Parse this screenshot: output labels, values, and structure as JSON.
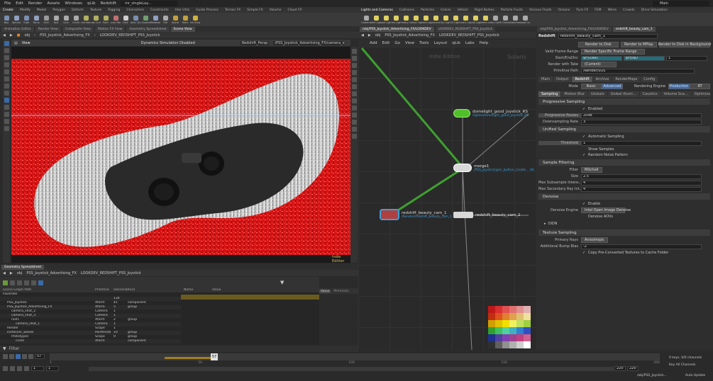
{
  "menu": [
    "File",
    "Edit",
    "Render",
    "Assets",
    "Windows",
    "qLib",
    "Redshift",
    "Labs",
    "Help"
  ],
  "desktop": "mr_singleLay...",
  "workspace": "Main",
  "shelf_tabs_left": [
    "Create",
    "Modify",
    "Model",
    "Polygon",
    "Deform",
    "Texture",
    "Rigging",
    "Characters",
    "Constraints",
    "Hair Utils",
    "Guide Process",
    "Terrain FX",
    "Simple FX",
    "Volume",
    "Cloud FX"
  ],
  "shelf_tabs_right": [
    "Lights and Cameras",
    "Collisions",
    "Particles",
    "Grains",
    "Vellum",
    "Rigid Bodies",
    "Particle Fluids",
    "Viscous Fluids",
    "Oceans",
    "Pyro FX",
    "FEM",
    "Wires",
    "Crowds",
    "Drive Simulation"
  ],
  "tools_left": [
    {
      "label": "Box",
      "color": "#7a8fb0"
    },
    {
      "label": "Sphere",
      "color": "#8fa0c0"
    },
    {
      "label": "Tube",
      "color": "#7a8fb0"
    },
    {
      "label": "Torus",
      "color": "#8fa0c0"
    },
    {
      "label": "Grid",
      "color": "#999"
    },
    {
      "label": "Null",
      "color": "#aaa"
    },
    {
      "label": "Line",
      "color": "#aaa"
    },
    {
      "label": "Circle",
      "color": "#aaa"
    },
    {
      "label": "Curve Bezier",
      "color": "#b0b060"
    },
    {
      "label": "Draw Curve",
      "color": "#b0b060"
    },
    {
      "label": "Path",
      "color": "#b0b060"
    },
    {
      "label": "Spray Paint",
      "color": "#c07070"
    },
    {
      "label": "Font",
      "color": "#ccc"
    },
    {
      "label": "Platonic Solids",
      "color": "#7a8fb0"
    },
    {
      "label": "L-System",
      "color": "#70a070"
    },
    {
      "label": "Metaball",
      "color": "#8fa0c0"
    },
    {
      "label": "File",
      "color": "#aaa"
    },
    {
      "label": "Spiral",
      "color": "#c0a040"
    },
    {
      "label": "Helix",
      "color": "#c0a040"
    },
    {
      "label": "Quick Shapes",
      "color": "#d0b040"
    }
  ],
  "tools_right": [
    {
      "label": "Camera",
      "color": "#aaa"
    },
    {
      "label": "Point Light",
      "color": "#e0d060"
    },
    {
      "label": "Spot Light",
      "color": "#e0d060"
    },
    {
      "label": "Area Light",
      "color": "#e0d060"
    },
    {
      "label": "Geometry Light",
      "color": "#e0d060"
    },
    {
      "label": "Volume Light",
      "color": "#e0d060"
    },
    {
      "label": "Distant Light",
      "color": "#e0d060"
    },
    {
      "label": "Environment Light",
      "color": "#e0d060"
    },
    {
      "label": "Sky Light",
      "color": "#e0d060"
    },
    {
      "label": "GI Light",
      "color": "#e0d060"
    },
    {
      "label": "Caustic Light",
      "color": "#e0d060"
    },
    {
      "label": "Portal Light",
      "color": "#e0d060"
    },
    {
      "label": "Ambient Light",
      "color": "#e0d060"
    },
    {
      "label": "Stereo Camera",
      "color": "#aaa"
    },
    {
      "label": "VR Camera",
      "color": "#aaa"
    },
    {
      "label": "Switcher",
      "color": "#aaa"
    },
    {
      "label": "Gamepad Camera",
      "color": "#aaa"
    }
  ],
  "left_pane_tabs": [
    "Animation Editor",
    "Render View",
    "Composite View",
    "Motion FX View",
    "Geometry Spreadsheet",
    "Scene View"
  ],
  "mid_pane_tabs": [
    "Take List",
    "Performance Monitor",
    "Render Scheduler"
  ],
  "right_pane_tabs": [
    "/obj/PSS_Joystick_Advertising_FX/LOOKDEV",
    "redshift_beauty_cam_1"
  ],
  "viewport": {
    "path_obj": "obj",
    "path_asset": "PSS_Joystick_Advertising_FX",
    "path_lookdev": "LOOKDEV_REDSHIFT_PSS_Joystick",
    "title": "View",
    "status": "Dynamics Simulation Disabled",
    "camera": "Redshift_Persp",
    "cam_path": "/PSS_Joystick_Advertising_FX/camera_shot_2",
    "renderer_note": "Indie Edition"
  },
  "spreadsheet": {
    "tab": "Geometry Spreadsheet",
    "path_asset": "PSS_Joystick_Advertising_FX",
    "path_lookdev": "LOOKDEV_REDSHIFT_PSS_Joystick",
    "cols": [
      "Scene Graph Path",
      "Primitive",
      "Descendants",
      "Kind"
    ],
    "rows": [
      [
        "Favorites",
        "",
        "",
        ""
      ],
      [
        "",
        "",
        "134",
        ""
      ],
      [
        "PSS_Joystick",
        "Xform",
        "41",
        "component"
      ],
      [
        "PSS_Joystick_Advertising_FX",
        "Xform",
        "5",
        "group"
      ],
      [
        "camera_shot_2",
        "Camera",
        "1",
        ""
      ],
      [
        "camera_shot_3",
        "Camera",
        "1",
        ""
      ],
      [
        "null1",
        "Xform",
        "2",
        "group"
      ],
      [
        "camera_shot_1",
        "Camera",
        "1",
        ""
      ],
      [
        "Render",
        "Scope",
        "1",
        ""
      ],
      [
        "instancer_waves",
        "PointInsta",
        "10",
        "group"
      ],
      [
        "Prototypes",
        "Scope",
        "9",
        "group"
      ],
      [
        "circle",
        "Xform",
        "",
        "component"
      ]
    ],
    "attr_cols": [
      "Name",
      "Value"
    ],
    "value_tab": "Value",
    "meta_tab": "Metadata",
    "filter": "Filter"
  },
  "network": {
    "tabs": [
      "/obj/PSS_Joystick_Advertising_FX/LOOKDEV",
      "LOOKDEV_REDSHIFT_PSS_Joystick"
    ],
    "menu": [
      "Add",
      "Edit",
      "Go",
      "View",
      "Tools",
      "Layout",
      "qLib",
      "Labs",
      "Help"
    ],
    "watermark": "Indie Edition",
    "context": "Solaris",
    "nodes": [
      {
        "name": "domelight_good_joystick_RS",
        "sub": "/lights/domelight_good_joystick_RS"
      },
      {
        "name": "merge1",
        "sub": "/PSS_Joystick/gen_button_create... (8)"
      },
      {
        "name": "redshift_beauty_cam_1",
        "sub": "/Render/redshift_beauty_cam_1"
      },
      {
        "name": "redshift_beauty_cam_2",
        "sub": ""
      }
    ]
  },
  "params": {
    "node_type": "Redshift",
    "node_name": "redshift_beauty_cam_1",
    "render_buttons": [
      "Render to Disk",
      "Render to MPlay",
      "Render to Disk in Background"
    ],
    "frame_range_label": "Valid Frame Range",
    "frame_range_value": "Render Specific Frame Range",
    "startend_label": "Start/End/Inc",
    "fstart": "$FSTART",
    "fend": "$FEND",
    "finc": "1",
    "take_label": "Render with Take",
    "take_value": "(Current)",
    "prim_label": "Primitive Path",
    "prim_value": "/Render/SOS",
    "tabs": [
      "Main",
      "Output",
      "Redshift",
      "Archive",
      "RenderMaps",
      "Config"
    ],
    "mode_label": "Mode",
    "mode_basic": "Basic",
    "mode_advanced": "Advanced",
    "engine_label": "Rendering Engine",
    "engine_prod": "Production",
    "engine_rt": "RT",
    "subtabs": [
      "Sampling",
      "Motion Blur",
      "Globals",
      "Global Illumi...",
      "Caustics",
      "Volume Sca...",
      "Optimizations",
      "System"
    ],
    "progressive": {
      "title": "Progressive Sampling",
      "enabled": "Enabled",
      "passes_label": "Progressive Passes",
      "passes": "2048",
      "down_label": "Downsampling Rate",
      "down": "3"
    },
    "unified": {
      "title": "Unified Sampling",
      "auto": "Automatic Sampling",
      "thr_label": "Threshold",
      "thr": "1",
      "show": "Show Samples",
      "noise": "Random Noise Pattern"
    },
    "filtering": {
      "title": "Sample Filtering",
      "filter_label": "Filter",
      "filter": "Mitchell",
      "size_label": "Size",
      "size": "2.5",
      "sub_label": "Max Subsample Intens...",
      "sub": "4",
      "sec_label": "Max Secondary Ray Int...",
      "sec": "4"
    },
    "denoise": {
      "title": "Denoise",
      "enable": "Enable",
      "engine_label": "Denoise Engine",
      "engine": "Intel Open Image Denoise",
      "aovs": "Denoise AOVs",
      "oidn": "OIDN"
    },
    "texture": {
      "title": "Texture Sampling",
      "rays_label": "Primary Rays",
      "rays": "Anisotropic",
      "bias_label": "Additional Bump Bias",
      "bias": "-2",
      "copy": "Copy Pre-Converted Textures to Cache Folder"
    }
  },
  "timeline": {
    "frame": "57",
    "start": "1",
    "end": "220",
    "end2": "220",
    "step": "1",
    "ticks": [
      "1",
      "50",
      "100",
      "150",
      "200"
    ],
    "keys": "0 keys, 0/0 channels",
    "key_all": "Key All Channels",
    "auto_update": "Auto Update",
    "obj_path": "/obj/PSS_Joystick..."
  },
  "palette": [
    "#c01818",
    "#d83030",
    "#e05050",
    "#e07070",
    "#e09090",
    "#e0b0b0",
    "#c03010",
    "#e05020",
    "#e08030",
    "#e0a050",
    "#e0c070",
    "#f0e0a0",
    "#d0a000",
    "#e0c000",
    "#f0e000",
    "#f0f060",
    "#c0e060",
    "#a0d040",
    "#30a030",
    "#40c060",
    "#50d0a0",
    "#40b0c0",
    "#3080d0",
    "#3050c0",
    "#203090",
    "#5040a0",
    "#8040b0",
    "#a04090",
    "#c04080",
    "#d06090",
    "#303030",
    "#606060",
    "#909090",
    "#b0b0b0",
    "#d0d0d0",
    "#ffffff"
  ]
}
